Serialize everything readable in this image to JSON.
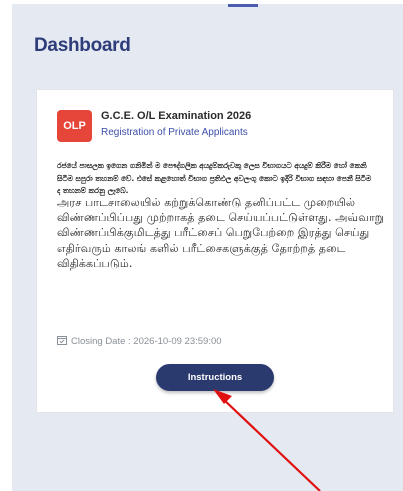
{
  "page": {
    "title": "Dashboard"
  },
  "card": {
    "badge": "OLP",
    "exam_name": "G.C.E. O/L Examination 2026",
    "exam_subtitle": "Registration of Private Applicants",
    "sinhala_text": "රජයේ පාසලක ඉගෙන ගනිමින් ම පෞද්ගලික අයදුම්කරුවකු ලෙස විභාගයට අයදුම් කිරීම හෝ කෙනි සිටීම සපුරා තහනම් වේ. එසේ කළහොත් විභාග ප්‍රතිඵල අවලංගු කොට ඉදිරි විභාග සඳහා පෙනී සිටීම ද තහනම් කරනු ලැබේ.",
    "tamil_text": "அரச பாடசாலையில் கற்றுக்கொண்டு தனிப்பட்ட முறையில் விண்ணப்பிப்பது முற்றாகத் தடை செய்யப்பட்டுள்ளது. அவ்வாறு விண்ணப்பிக்குமிடத்து பரீட்சைப் பெறுபேற்றை இரத்து செய்து எதிர்வரும் காலங் களில் பரீட்சைகளுக்குத் தோற்றத் தடை விதிக்கப்படும்.",
    "closing_date": "Closing Date : 2026-10-09 23:59:00",
    "button_label": "Instructions"
  },
  "colors": {
    "panel_bg": "#e5e9f2",
    "title": "#2e3d7a",
    "badge": "#e6453a",
    "button": "#2b3a6e",
    "annotation_arrow": "#e01010"
  },
  "icons": {
    "closing": "calendar-check-icon"
  }
}
